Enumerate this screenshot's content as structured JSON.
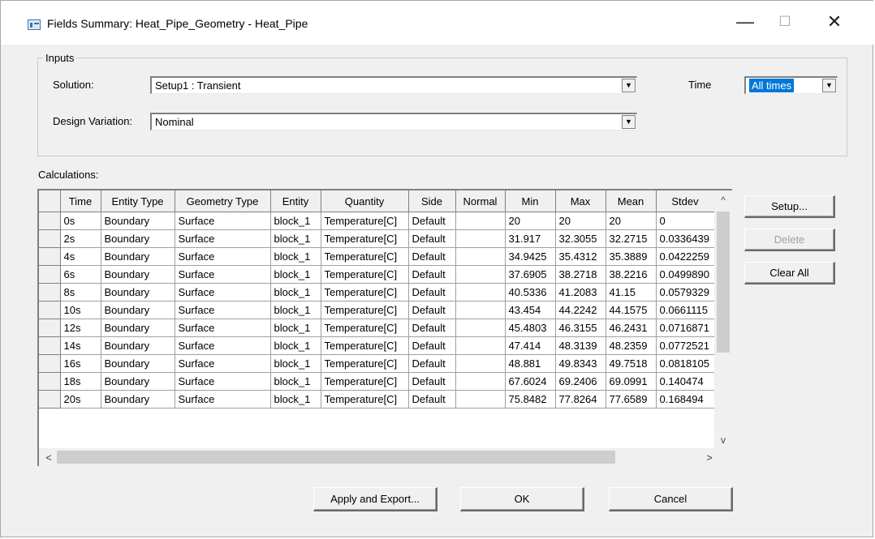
{
  "window": {
    "title": "Fields Summary: Heat_Pipe_Geometry - Heat_Pipe",
    "minimize_glyph": "—",
    "maximize_glyph": "☐",
    "close_glyph": "✕"
  },
  "inputs": {
    "group_title": "Inputs",
    "solution_label": "Solution:",
    "solution_value": "Setup1 : Transient",
    "design_variation_label": "Design Variation:",
    "design_variation_value": "Nominal",
    "time_label": "Time",
    "time_value": "All times",
    "dropdown_glyph": "▼"
  },
  "calculations": {
    "label": "Calculations:",
    "columns": [
      "Time",
      "Entity Type",
      "Geometry Type",
      "Entity",
      "Quantity",
      "Side",
      "Normal",
      "Min",
      "Max",
      "Mean",
      "Stdev"
    ],
    "rows": [
      [
        "0s",
        "Boundary",
        "Surface",
        "block_1",
        "Temperature[C]",
        "Default",
        "",
        "20",
        "20",
        "20",
        "0"
      ],
      [
        "2s",
        "Boundary",
        "Surface",
        "block_1",
        "Temperature[C]",
        "Default",
        "",
        "31.917",
        "32.3055",
        "32.2715",
        "0.0336439"
      ],
      [
        "4s",
        "Boundary",
        "Surface",
        "block_1",
        "Temperature[C]",
        "Default",
        "",
        "34.9425",
        "35.4312",
        "35.3889",
        "0.0422259"
      ],
      [
        "6s",
        "Boundary",
        "Surface",
        "block_1",
        "Temperature[C]",
        "Default",
        "",
        "37.6905",
        "38.2718",
        "38.2216",
        "0.0499890"
      ],
      [
        "8s",
        "Boundary",
        "Surface",
        "block_1",
        "Temperature[C]",
        "Default",
        "",
        "40.5336",
        "41.2083",
        "41.15",
        "0.0579329"
      ],
      [
        "10s",
        "Boundary",
        "Surface",
        "block_1",
        "Temperature[C]",
        "Default",
        "",
        "43.454",
        "44.2242",
        "44.1575",
        "0.0661115"
      ],
      [
        "12s",
        "Boundary",
        "Surface",
        "block_1",
        "Temperature[C]",
        "Default",
        "",
        "45.4803",
        "46.3155",
        "46.2431",
        "0.0716871"
      ],
      [
        "14s",
        "Boundary",
        "Surface",
        "block_1",
        "Temperature[C]",
        "Default",
        "",
        "47.414",
        "48.3139",
        "48.2359",
        "0.0772521"
      ],
      [
        "16s",
        "Boundary",
        "Surface",
        "block_1",
        "Temperature[C]",
        "Default",
        "",
        "48.881",
        "49.8343",
        "49.7518",
        "0.0818105"
      ],
      [
        "18s",
        "Boundary",
        "Surface",
        "block_1",
        "Temperature[C]",
        "Default",
        "",
        "67.6024",
        "69.2406",
        "69.0991",
        "0.140474"
      ],
      [
        "20s",
        "Boundary",
        "Surface",
        "block_1",
        "Temperature[C]",
        "Default",
        "",
        "75.8482",
        "77.8264",
        "77.6589",
        "0.168494"
      ]
    ],
    "scroll_up_glyph": "^",
    "scroll_down_glyph": "v",
    "scroll_left_glyph": "<",
    "scroll_right_glyph": ">"
  },
  "side_buttons": {
    "setup": "Setup...",
    "delete": "Delete",
    "clear_all": "Clear All"
  },
  "footer_buttons": {
    "apply_export": "Apply and Export...",
    "ok": "OK",
    "cancel": "Cancel"
  }
}
